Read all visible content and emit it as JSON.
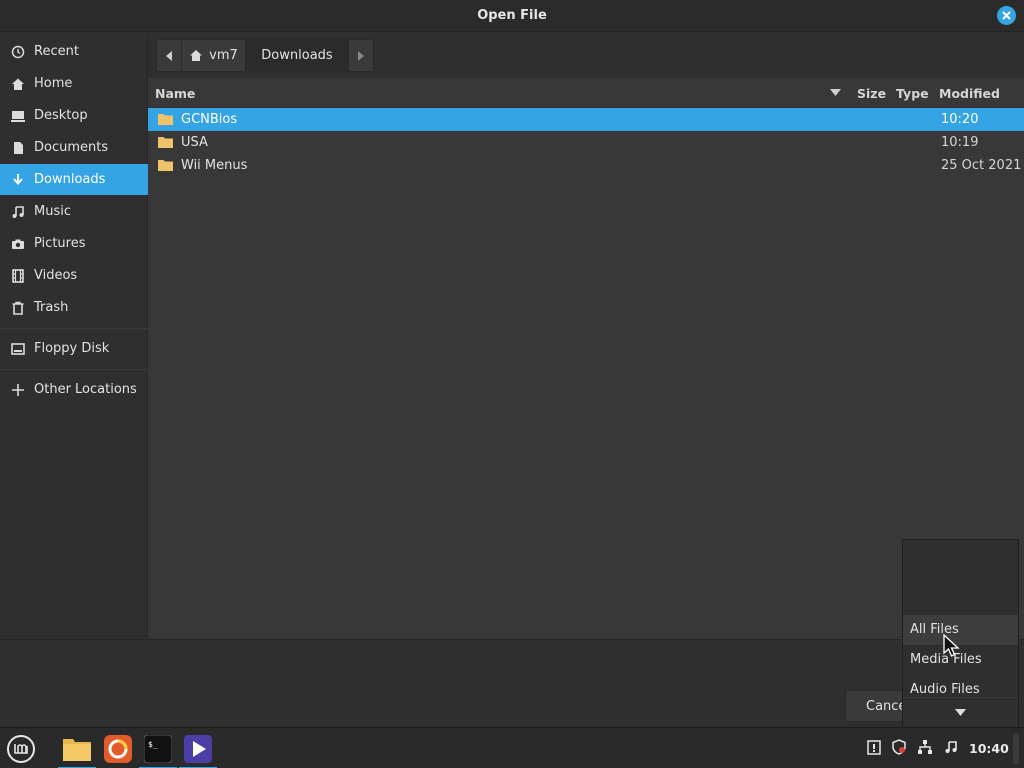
{
  "window": {
    "title": "Open File"
  },
  "sidebar": {
    "items": [
      {
        "label": "Recent",
        "icon": "clock-icon"
      },
      {
        "label": "Home",
        "icon": "home-icon"
      },
      {
        "label": "Desktop",
        "icon": "desktop-icon"
      },
      {
        "label": "Documents",
        "icon": "document-icon"
      },
      {
        "label": "Downloads",
        "icon": "download-icon",
        "active": true
      },
      {
        "label": "Music",
        "icon": "music-note-icon"
      },
      {
        "label": "Pictures",
        "icon": "camera-icon"
      },
      {
        "label": "Videos",
        "icon": "film-icon"
      },
      {
        "label": "Trash",
        "icon": "trash-icon"
      },
      {
        "label": "Floppy Disk",
        "icon": "drive-icon"
      },
      {
        "label": "Other Locations",
        "icon": "plus-icon"
      }
    ]
  },
  "pathbar": {
    "home_label": "vm7",
    "current_label": "Downloads"
  },
  "columns": {
    "name": "Name",
    "size": "Size",
    "type": "Type",
    "modified": "Modified"
  },
  "files": [
    {
      "name": "GCNBios",
      "modified": "10:20",
      "selected": true
    },
    {
      "name": "USA",
      "modified": "10:19"
    },
    {
      "name": "Wii Menus",
      "modified": "25 Oct 2021"
    }
  ],
  "footer": {
    "cancel_label": "Cancel"
  },
  "filter_dropdown": {
    "options": [
      "All Files",
      "Media Files",
      "Audio Files"
    ],
    "highlighted": "All Files"
  },
  "taskbar": {
    "clock": "10:40"
  },
  "colors": {
    "accent": "#35a4e4",
    "folder": "#f0c36a",
    "background": "#2f2f2f"
  }
}
